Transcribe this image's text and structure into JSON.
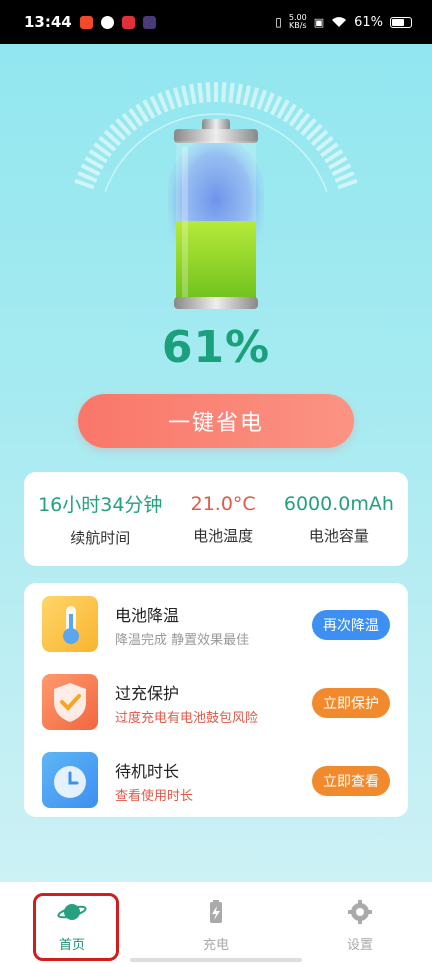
{
  "status": {
    "time": "13:44",
    "net_speed_value": "5.00",
    "net_speed_unit": "KB/s",
    "battery_pct": "61%"
  },
  "battery": {
    "level": 0.61,
    "percent_text": "61%"
  },
  "actions": {
    "save_label": "一键省电"
  },
  "stats": [
    {
      "value": "16小时34分钟",
      "label": "续航时间",
      "color": "#24a17c"
    },
    {
      "value": "21.0°C",
      "label": "电池温度",
      "color": "#e05a48"
    },
    {
      "value": "6000.0mAh",
      "label": "电池容量",
      "color": "#24a17c"
    }
  ],
  "features": [
    {
      "title": "电池降温",
      "subtitle": "降温完成 静置效果最佳",
      "button": "再次降温",
      "icon": "thermometer-icon",
      "sub_color": "#999999"
    },
    {
      "title": "过充保护",
      "subtitle": "过度充电有电池鼓包风险",
      "button": "立即保护",
      "icon": "shield-check-icon",
      "sub_color": "#e05a48"
    },
    {
      "title": "待机时长",
      "subtitle": "查看使用时长",
      "button": "立即查看",
      "icon": "clock-icon",
      "sub_color": "#e05a48"
    }
  ],
  "nav": [
    {
      "label": "首页",
      "icon": "planet-icon",
      "active": true
    },
    {
      "label": "充电",
      "icon": "charge-icon",
      "active": false
    },
    {
      "label": "设置",
      "icon": "gear-icon",
      "active": false
    }
  ],
  "colors": {
    "accent": "#24a17c",
    "save_button": "#f9776a",
    "highlight": "#d11d1d"
  }
}
